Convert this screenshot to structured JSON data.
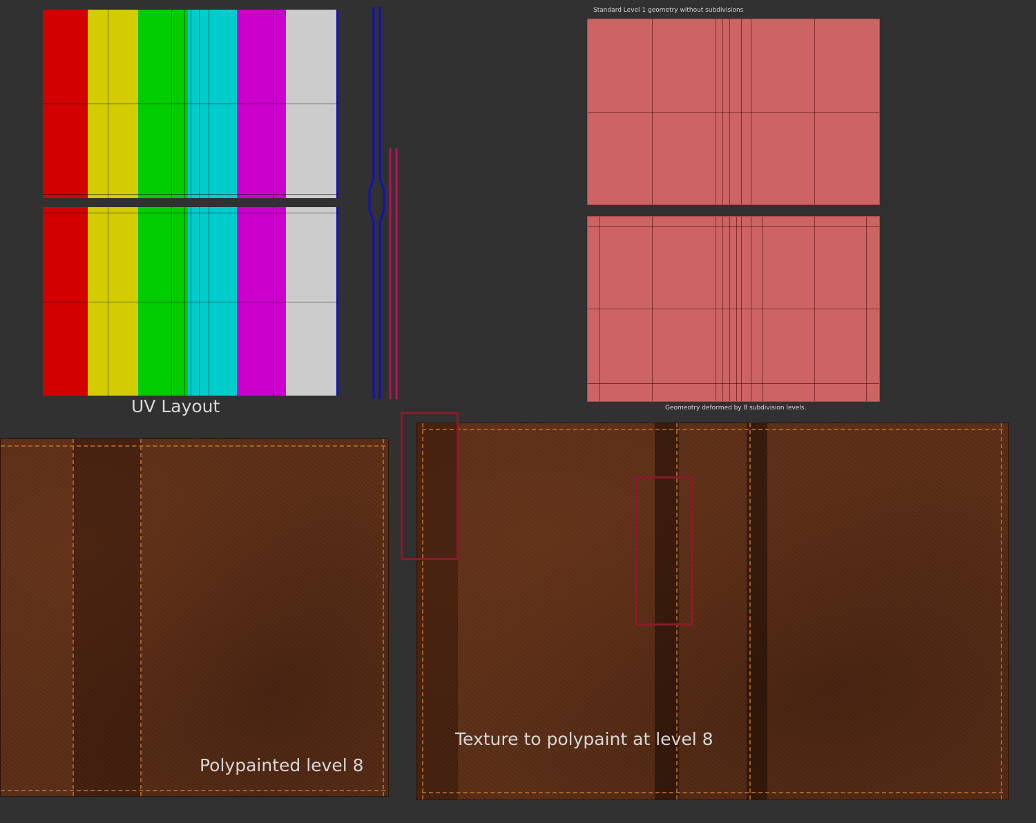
{
  "labels": {
    "uv_layout": "UV Layout",
    "level1": "Standard Level 1 geometry without subdivisions",
    "deformed": "Geomeotry deformed by 8 subdivision levels.",
    "polypainted": "Polypainted level 8",
    "texture_to_polypaint": "Texture to polypaint at level 8"
  },
  "colors": {
    "uv_strips": [
      "#d20000",
      "#d2cc00",
      "#00cc00",
      "#00cccc",
      "#cc00cc",
      "#cccccc"
    ],
    "uv_edge": "#1010c0",
    "geometry": "#cd6464",
    "highlight_box": "#8b1a2a"
  }
}
